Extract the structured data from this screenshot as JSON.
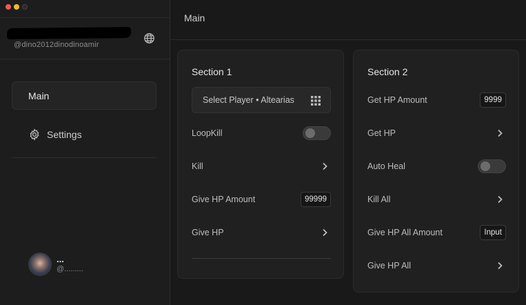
{
  "sidebar": {
    "handle": "@dino2012dinodinoamir",
    "nav": [
      {
        "label": "Main"
      },
      {
        "label": "Settings"
      }
    ],
    "profile": {
      "name": "...",
      "handle": "@........."
    }
  },
  "main": {
    "title": "Main",
    "section1": {
      "title": "Section 1",
      "select_label": "Select Player • Altearias",
      "loopkill": "LoopKill",
      "kill": "Kill",
      "give_hp_amount": "Give HP Amount",
      "give_hp_amount_value": "99999",
      "give_hp": "Give HP"
    },
    "section2": {
      "title": "Section 2",
      "get_hp_amount": "Get HP Amount",
      "get_hp_amount_value": "9999",
      "get_hp": "Get HP",
      "auto_heal": "Auto Heal",
      "kill_all": "Kill All",
      "give_hp_all_amount": "Give HP All Amount",
      "give_hp_all_amount_value": "Input",
      "give_hp_all": "Give HP All"
    }
  },
  "icons": [
    "globe-icon",
    "gear-icon",
    "grid-icon",
    "chevron-right-icon"
  ],
  "colors": {
    "background": "#1b1b1b",
    "panel": "#202020",
    "close": "#ee5a52",
    "minimize": "#f3b72c"
  }
}
